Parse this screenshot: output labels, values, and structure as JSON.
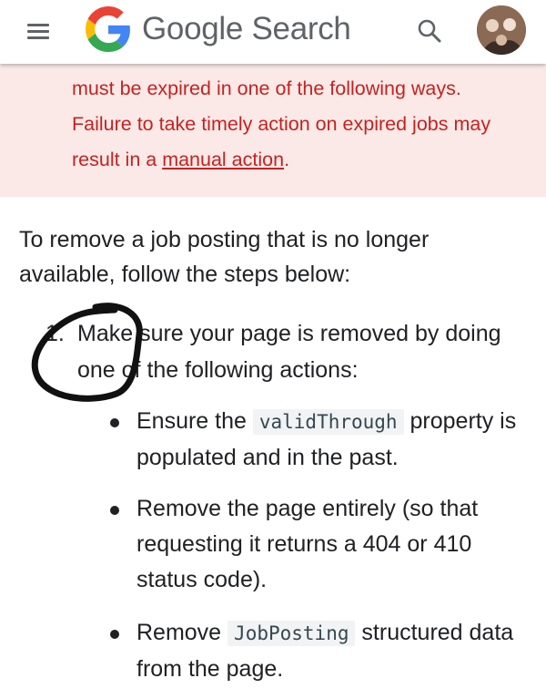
{
  "header": {
    "brand": "Google Search",
    "menu_icon": "hamburger-menu-icon",
    "search_icon": "search-icon",
    "avatar_icon": "user-avatar",
    "colors": {
      "blue": "#4285F4",
      "red": "#EA4335",
      "yellow": "#FBBC05",
      "green": "#34A853",
      "gray": "#5f6368"
    }
  },
  "warning": {
    "line1": "must be expired in one of the following ways.",
    "line2": "Failure to take timely action on expired jobs may",
    "line3_prefix": "result in a ",
    "link": "manual action",
    "line3_suffix": ".",
    "text_color": "#c5221f",
    "background": "#fbe9e8"
  },
  "content": {
    "intro": "To remove a job posting that is no longer available, follow the steps below:",
    "step1": {
      "number": "1.",
      "text": "Make sure your page is removed by doing one of the following actions:"
    },
    "items": [
      {
        "before": "Ensure the ",
        "code": "validThrough",
        "after": " property is populated and in the past."
      },
      {
        "text": "Remove the page entirely (so that requesting it returns a 404 or 410 status code)."
      },
      {
        "before": "Remove ",
        "code": "JobPosting",
        "after": " structured data from the page."
      }
    ]
  }
}
